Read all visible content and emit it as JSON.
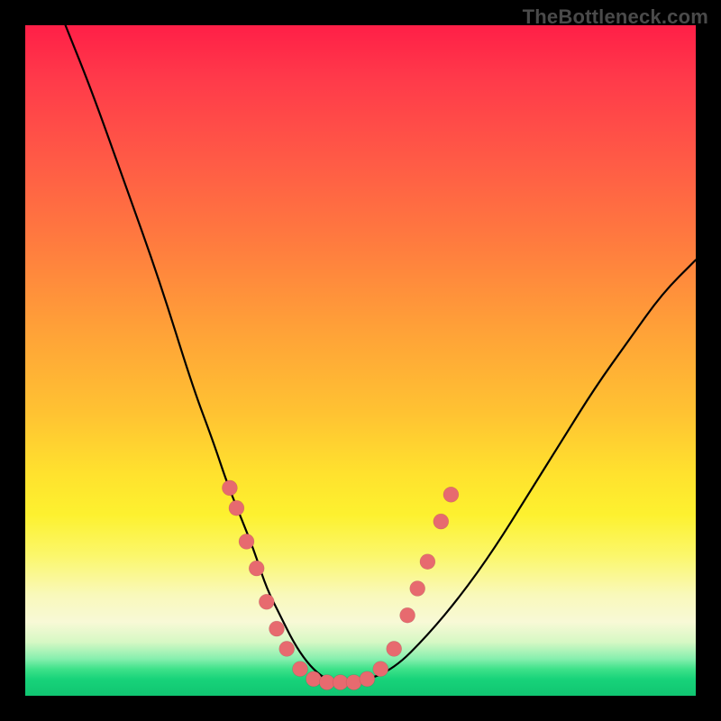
{
  "watermark": "TheBottleneck.com",
  "colors": {
    "background": "#000000",
    "gradient_top": "#ff1f47",
    "gradient_mid": "#ffe22e",
    "gradient_bottom": "#10c571",
    "curve": "#000000",
    "marker": "#e76a6f"
  },
  "chart_data": {
    "type": "line",
    "title": "",
    "xlabel": "",
    "ylabel": "",
    "xlim": [
      0,
      100
    ],
    "ylim": [
      0,
      100
    ],
    "series": [
      {
        "name": "bottleneck-curve",
        "x": [
          6,
          10,
          15,
          20,
          25,
          28,
          30,
          32,
          34,
          36,
          38,
          40,
          42,
          44,
          46,
          48,
          50,
          55,
          60,
          65,
          70,
          75,
          80,
          85,
          90,
          95,
          100
        ],
        "y": [
          100,
          90,
          76,
          62,
          46,
          38,
          32,
          27,
          22,
          16,
          12,
          8,
          5,
          3,
          2,
          2,
          2,
          4,
          9,
          15,
          22,
          30,
          38,
          46,
          53,
          60,
          65
        ]
      }
    ],
    "markers": [
      {
        "x": 30.5,
        "y": 31
      },
      {
        "x": 31.5,
        "y": 28
      },
      {
        "x": 33,
        "y": 23
      },
      {
        "x": 34.5,
        "y": 19
      },
      {
        "x": 36,
        "y": 14
      },
      {
        "x": 37.5,
        "y": 10
      },
      {
        "x": 39,
        "y": 7
      },
      {
        "x": 41,
        "y": 4
      },
      {
        "x": 43,
        "y": 2.5
      },
      {
        "x": 45,
        "y": 2
      },
      {
        "x": 47,
        "y": 2
      },
      {
        "x": 49,
        "y": 2
      },
      {
        "x": 51,
        "y": 2.5
      },
      {
        "x": 53,
        "y": 4
      },
      {
        "x": 55,
        "y": 7
      },
      {
        "x": 57,
        "y": 12
      },
      {
        "x": 58.5,
        "y": 16
      },
      {
        "x": 60,
        "y": 20
      },
      {
        "x": 62,
        "y": 26
      },
      {
        "x": 63.5,
        "y": 30
      }
    ]
  }
}
